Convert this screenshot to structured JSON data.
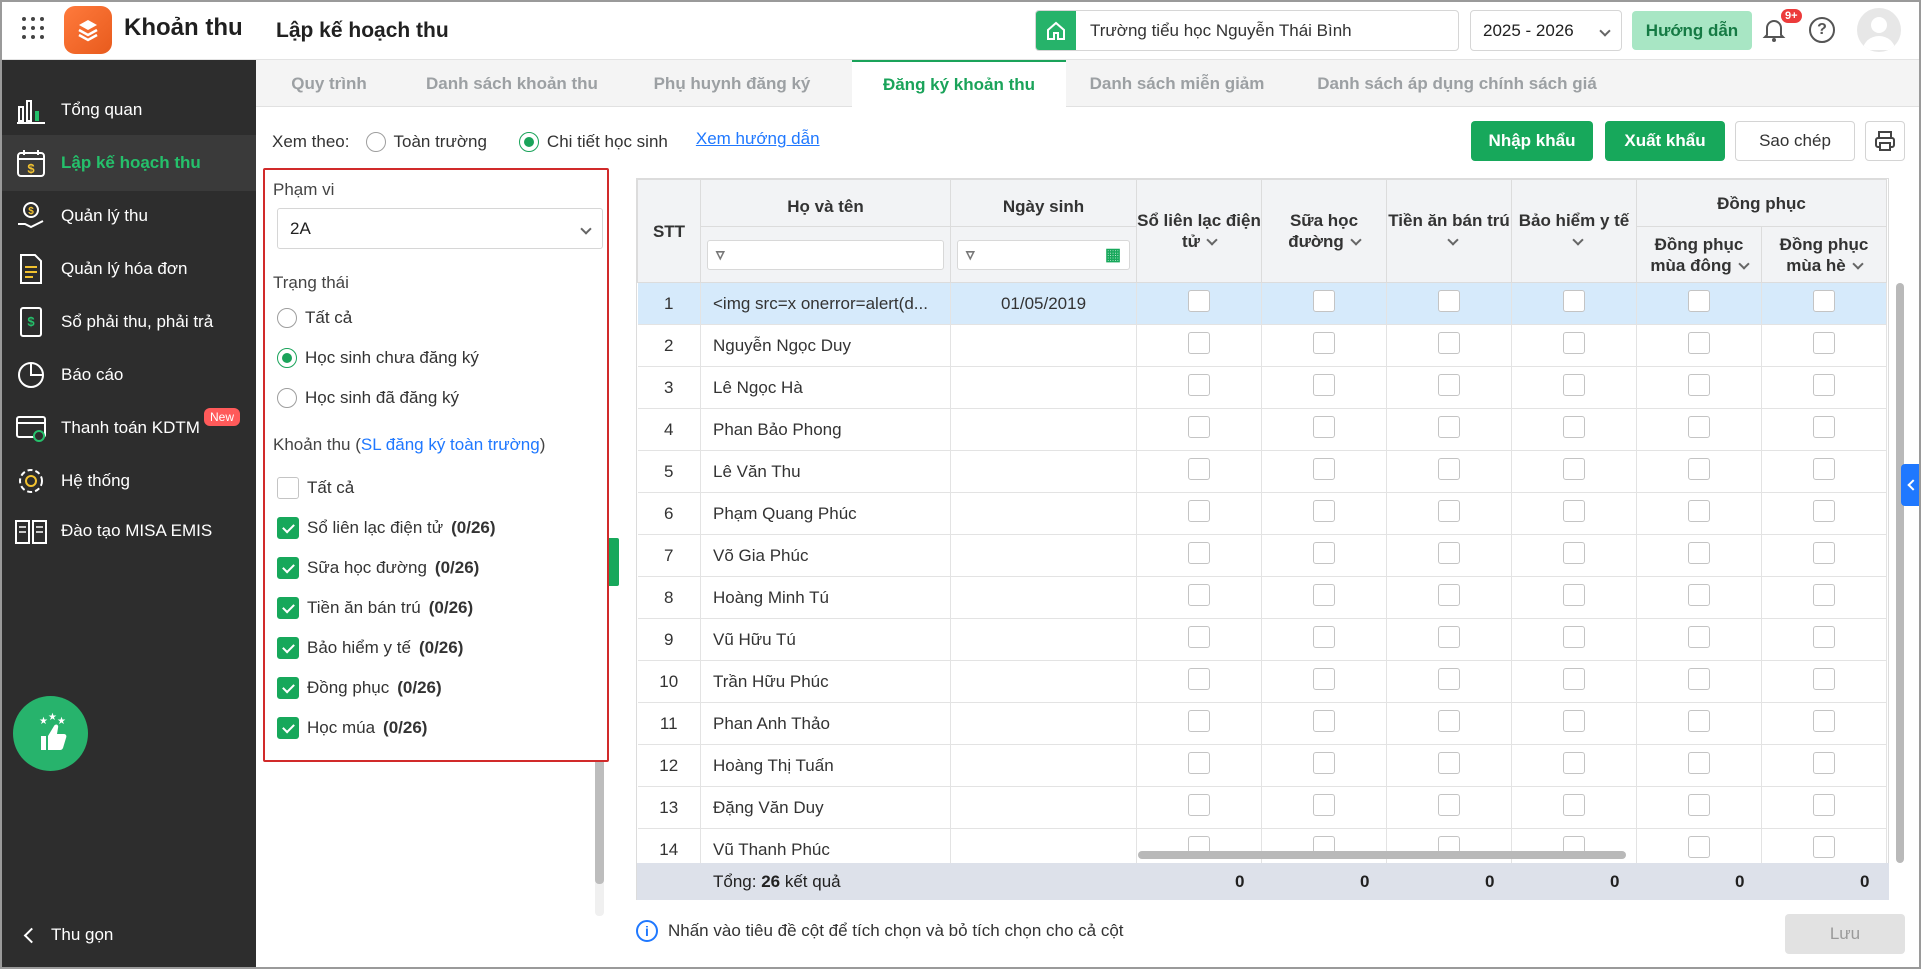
{
  "header": {
    "app_title": "Khoản thu",
    "page_title": "Lập kế hoạch thu",
    "school": "Trường tiểu học Nguyễn Thái Bình",
    "year": "2025 - 2026",
    "guide_label": "Hướng dẫn",
    "notification_count": "9+"
  },
  "sidebar": {
    "items": [
      {
        "label": "Tổng quan",
        "icon": "chart-bars-icon"
      },
      {
        "label": "Lập kế hoạch thu",
        "icon": "calendar-money-icon",
        "active": true
      },
      {
        "label": "Quản lý thu",
        "icon": "hand-money-icon"
      },
      {
        "label": "Quản lý hóa đơn",
        "icon": "invoice-icon"
      },
      {
        "label": "Sổ phải thu, phải trả",
        "icon": "ledger-icon"
      },
      {
        "label": "Báo cáo",
        "icon": "pie-chart-icon"
      },
      {
        "label": "Thanh toán KDTM",
        "icon": "card-payment-icon",
        "badge": "New"
      },
      {
        "label": "Hệ thống",
        "icon": "gear-icon"
      },
      {
        "label": "Đào tạo MISA EMIS",
        "icon": "book-icon"
      }
    ],
    "collapse_label": "Thu gọn"
  },
  "tabs": [
    "Quy trình",
    "Danh sách khoản thu",
    "Phụ huynh đăng ký",
    "Đăng ký khoản thu",
    "Danh sách miễn giảm",
    "Danh sách áp dụng chính sách giá"
  ],
  "view": {
    "label": "Xem theo:",
    "option_school": "Toàn trường",
    "option_detail": "Chi tiết học sinh",
    "guide_link": "Xem hướng dẫn"
  },
  "actions": {
    "import": "Nhập khẩu",
    "export": "Xuất khẩu",
    "copy": "Sao chép"
  },
  "filter": {
    "scope_label": "Phạm vi",
    "scope_value": "2A",
    "status_label": "Trạng thái",
    "status_options": [
      "Tất cả",
      "Học sinh chưa đăng ký",
      "Học sinh đã đăng ký"
    ],
    "fees_label": "Khoản thu (",
    "fees_link": "SL đăng ký toàn trường",
    "fees_close": ")",
    "all_label": "Tất cả",
    "fees": [
      {
        "name": "Sổ liên lạc điện tử",
        "count": "(0/26)"
      },
      {
        "name": "Sữa học đường",
        "count": "(0/26)"
      },
      {
        "name": "Tiền ăn bán trú",
        "count": "(0/26)"
      },
      {
        "name": "Bảo hiểm y tế",
        "count": "(0/26)"
      },
      {
        "name": "Đồng phục",
        "count": "(0/26)"
      },
      {
        "name": "Học múa",
        "count": "(0/26)"
      }
    ]
  },
  "table": {
    "headers": {
      "stt": "STT",
      "name": "Họ và tên",
      "dob": "Ngày sinh",
      "c1": "Sổ liên lạc điện tử",
      "c2": "Sữa học đường",
      "c3": "Tiền ăn bán trú",
      "c4": "Bảo hiểm y tế",
      "group": "Đồng phục",
      "c5": "Đồng phục mùa đông",
      "c6": "Đồng phục mùa hè"
    },
    "rows": [
      {
        "stt": "1",
        "name": "<img src=x onerror=alert(d...",
        "dob": "01/05/2019"
      },
      {
        "stt": "2",
        "name": "Nguyễn Ngọc Duy",
        "dob": ""
      },
      {
        "stt": "3",
        "name": "Lê Ngọc Hà",
        "dob": ""
      },
      {
        "stt": "4",
        "name": "Phan Bảo Phong",
        "dob": ""
      },
      {
        "stt": "5",
        "name": "Lê Văn Thu",
        "dob": ""
      },
      {
        "stt": "6",
        "name": "Phạm Quang Phúc",
        "dob": ""
      },
      {
        "stt": "7",
        "name": "Võ Gia Phúc",
        "dob": ""
      },
      {
        "stt": "8",
        "name": "Hoàng Minh Tú",
        "dob": ""
      },
      {
        "stt": "9",
        "name": "Vũ Hữu Tú",
        "dob": ""
      },
      {
        "stt": "10",
        "name": "Trần Hữu Phúc",
        "dob": ""
      },
      {
        "stt": "11",
        "name": "Phan Anh Thảo",
        "dob": ""
      },
      {
        "stt": "12",
        "name": "Hoàng Thị Tuấn",
        "dob": ""
      },
      {
        "stt": "13",
        "name": "Đặng Văn Duy",
        "dob": ""
      },
      {
        "stt": "14",
        "name": "Vũ Thanh Phúc",
        "dob": ""
      }
    ],
    "total_prefix": "Tổng: ",
    "total_count": "26",
    "total_suffix": " kết quả",
    "totals": [
      "0",
      "0",
      "0",
      "0",
      "0",
      "0"
    ]
  },
  "footer": {
    "note": "Nhấn vào tiêu đề cột để tích chọn và bỏ tích chọn cho cả cột",
    "save": "Lưu"
  },
  "colors": {
    "accent": "#17a85b",
    "link": "#1f78ff",
    "sidebar": "#2d2d2d",
    "highlight": "#d12a2a"
  }
}
